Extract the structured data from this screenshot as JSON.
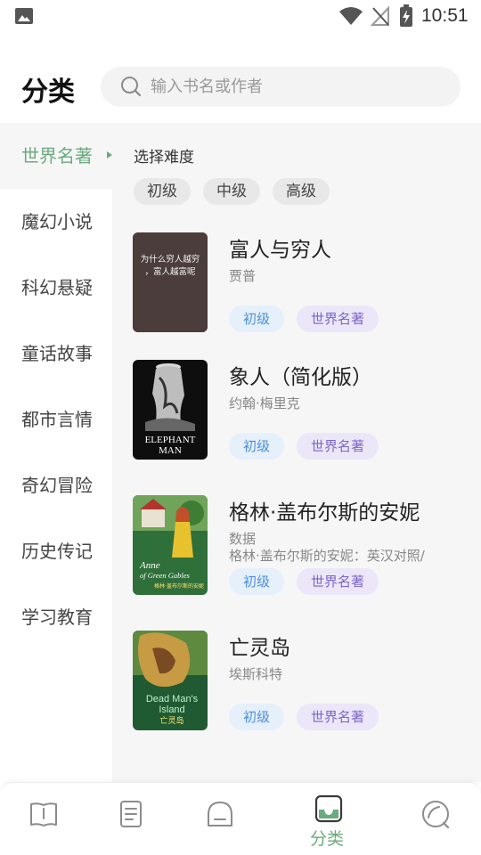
{
  "status_bar": {
    "time": "10:51",
    "icons": [
      "gallery-icon",
      "wifi-icon",
      "signal-icon",
      "battery-icon"
    ]
  },
  "header": {
    "title": "分类",
    "search_placeholder": "输入书名或作者"
  },
  "sidebar": {
    "items": [
      {
        "label": "世界名著",
        "active": true
      },
      {
        "label": "魔幻小说",
        "active": false
      },
      {
        "label": "科幻悬疑",
        "active": false
      },
      {
        "label": "童话故事",
        "active": false
      },
      {
        "label": "都市言情",
        "active": false
      },
      {
        "label": "奇幻冒险",
        "active": false
      },
      {
        "label": "历史传记",
        "active": false
      },
      {
        "label": "学习教育",
        "active": false
      }
    ]
  },
  "filter": {
    "label": "选择难度",
    "options": [
      "初级",
      "中级",
      "高级"
    ]
  },
  "books": [
    {
      "title": "富人与穷人",
      "author": "贾普",
      "desc": "",
      "level": "初级",
      "genre": "世界名著",
      "cover_text": [
        "为什么穷人越穷",
        "，富人越富呢"
      ]
    },
    {
      "title": "象人（简化版）",
      "author": "约翰·梅里克",
      "desc": "",
      "level": "初级",
      "genre": "世界名著",
      "cover_text": [
        "ELEPHANT",
        "MAN"
      ]
    },
    {
      "title": "格林·盖布尔斯的安妮",
      "author": "数据",
      "desc": "格林·盖布尔斯的安妮：英汉对照/",
      "level": "初级",
      "genre": "世界名著",
      "cover_text": [
        "Anne",
        "of Green Gables",
        "格林·盖布尔斯的安妮"
      ]
    },
    {
      "title": "亡灵岛",
      "author": "埃斯科特",
      "desc": "",
      "level": "初级",
      "genre": "世界名著",
      "cover_text": [
        "Dead Man's",
        "Island",
        "亡灵岛"
      ]
    }
  ],
  "bottom_nav": {
    "items": [
      {
        "icon": "book-open-icon",
        "label": ""
      },
      {
        "icon": "document-icon",
        "label": ""
      },
      {
        "icon": "bookshelf-icon",
        "label": ""
      },
      {
        "icon": "inbox-icon",
        "label": "分类",
        "active": true
      },
      {
        "icon": "discover-icon",
        "label": ""
      }
    ]
  },
  "colors": {
    "accent": "#6aab7e",
    "level_tag": "#4e8fd8",
    "genre_tag": "#7d66c9",
    "content_bg": "#f6f6f6"
  }
}
